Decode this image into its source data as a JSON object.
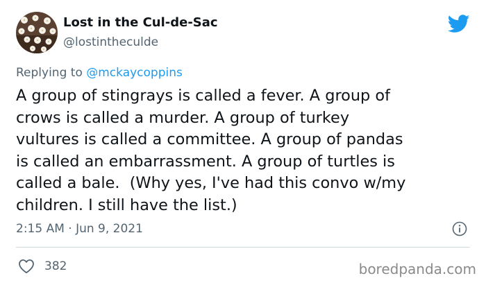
{
  "profile": {
    "display_name": "Lost in the Cul-de-Sac",
    "handle": "@lostintheculde",
    "avatar_icon": "flower-avatar"
  },
  "logo_icon": "twitter-bird-icon",
  "reply": {
    "prefix": "Replying to ",
    "mention": "@mckaycoppins"
  },
  "tweet": {
    "text": "A group of stingrays is called a fever. A group of\ncrows is called a murder. A group of turkey\nvultures is called a committee. A group of pandas\nis called an embarrassment. A group of turtles is\ncalled a bale.  (Why yes, I've had this convo w/my\nchildren. I still have the list.)",
    "timestamp": "2:15 AM · Jun 9, 2021"
  },
  "actions": {
    "likes": "382"
  },
  "watermark": "boredpanda.com",
  "colors": {
    "text": "#0f1419",
    "secondary": "#536471",
    "accent": "#1d9bf0",
    "divider": "#cfd9de"
  }
}
